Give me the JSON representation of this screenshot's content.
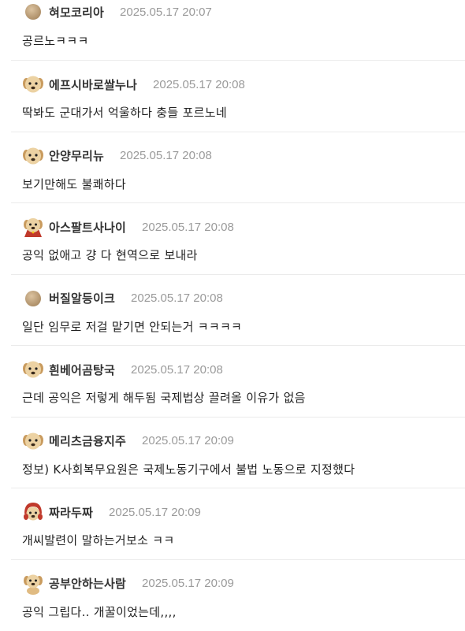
{
  "comments": [
    {
      "nick": "혀모코리아",
      "date": "2025.05.17 20:07",
      "text": "공르노ㅋㅋㅋ",
      "avatar_icon": "beige-circle-icon"
    },
    {
      "nick": "에프시바로쌀누나",
      "date": "2025.05.17 20:08",
      "text": "딱봐도 군대가서 억울하다 충들 포르노네",
      "avatar_icon": "puppy-icon"
    },
    {
      "nick": "안양무리뉴",
      "date": "2025.05.17 20:08",
      "text": "보기만해도 불쾌하다",
      "avatar_icon": "puppy-icon"
    },
    {
      "nick": "아스팔트사나이",
      "date": "2025.05.17 20:08",
      "text": "공익 없애고 걍 다 현역으로 보내라",
      "avatar_icon": "puppy-red-cape-icon"
    },
    {
      "nick": "버질알등이크",
      "date": "2025.05.17 20:08",
      "text": "일단 임무로 저걸 맡기면 안되는거 ㅋㅋㅋㅋ",
      "avatar_icon": "beige-circle-icon"
    },
    {
      "nick": "흰베어곰탕국",
      "date": "2025.05.17 20:08",
      "text": "근데 공익은 저렇게 해두됨 국제법상 끌려올 이유가 없음",
      "avatar_icon": "puppy-icon"
    },
    {
      "nick": "메리츠금융지주",
      "date": "2025.05.17 20:09",
      "text": "정보) K사회복무요원은 국제노동기구에서 불법 노동으로 지정했다",
      "avatar_icon": "puppy-icon"
    },
    {
      "nick": "짜라두짜",
      "date": "2025.05.17 20:09",
      "text": "개씨발련이 말하는거보소 ㅋㅋ",
      "avatar_icon": "puppy-red-hood-icon"
    },
    {
      "nick": "공부안하는사람",
      "date": "2025.05.17 20:09",
      "text": "공익 그립다.. 개꿀이었는데,,,,",
      "avatar_icon": "puppy-sitting-icon"
    }
  ],
  "colors": {
    "nick": "#333333",
    "date": "#9a9a9a",
    "text": "#222222",
    "divider": "#ebebeb",
    "avatar_beige": "#c9ad88",
    "puppy_fur": "#e8c58e",
    "cape_red": "#c0392b"
  }
}
